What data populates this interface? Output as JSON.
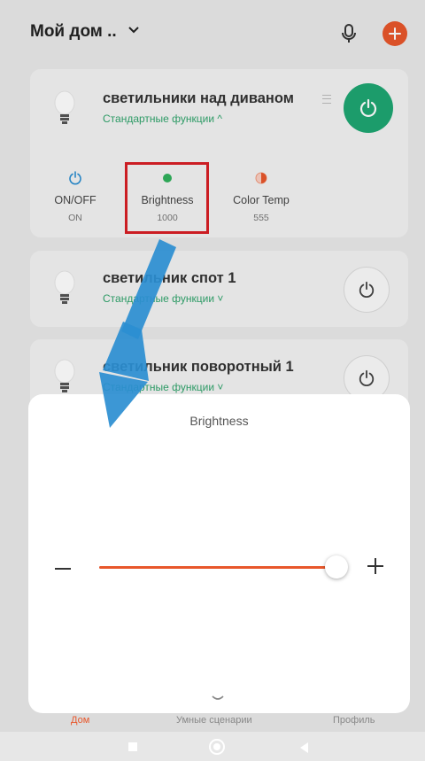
{
  "header": {
    "home_title": "Мой дом ..",
    "chevron_icon": "chevron-down-icon",
    "mic_icon": "microphone-icon",
    "add_icon": "plus-icon"
  },
  "devices": [
    {
      "name": "светильники над диваном",
      "subtitle": "Стандартные функции ^",
      "power_state": "on",
      "functions": [
        {
          "icon": "power-icon",
          "label": "ON/OFF",
          "value": "ON"
        },
        {
          "icon": "dot-icon",
          "label": "Brightness",
          "value": "1000"
        },
        {
          "icon": "half-circle-icon",
          "label": "Color Temp",
          "value": "555"
        }
      ]
    },
    {
      "name": "светильник спот 1",
      "subtitle": "Стандартные функции ˅",
      "power_state": "off"
    },
    {
      "name": "светильник поворотный 1",
      "subtitle": "Стандартные функции ˅",
      "power_state": "off"
    }
  ],
  "sheet": {
    "title": "Brightness",
    "slider_value": 1000,
    "slider_fraction": 1.0,
    "minus_icon": "minus-icon",
    "plus_icon": "plus-icon",
    "collapse_icon": "chevron-down-icon"
  },
  "tabs": [
    {
      "label": "Дом",
      "active": true
    },
    {
      "label": "Умные сценарии",
      "active": false
    },
    {
      "label": "Профиль",
      "active": false
    }
  ],
  "colors": {
    "accent": "#e8572b",
    "green": "#1ea672",
    "annotation_red": "#d81f26",
    "annotation_arrow": "#2b8ed1"
  }
}
